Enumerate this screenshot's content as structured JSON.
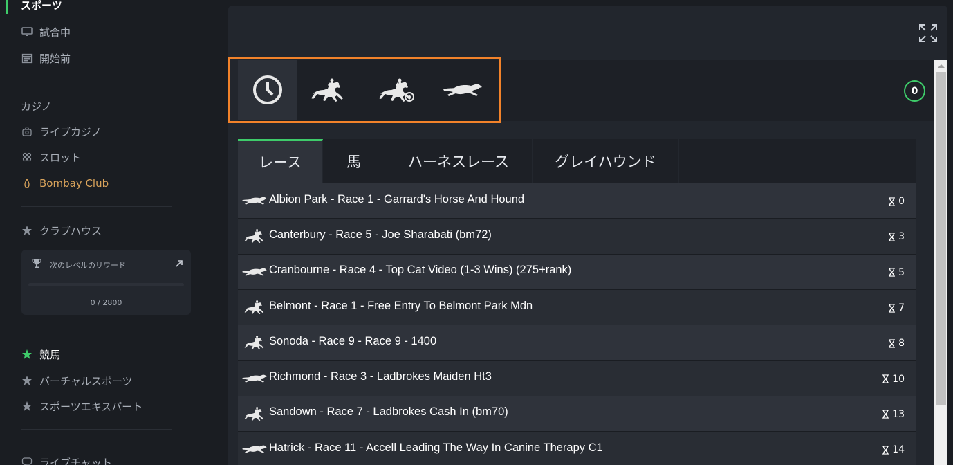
{
  "sidebar": {
    "sports_title": "スポーツ",
    "live": "試合中",
    "upcoming": "開始前",
    "casino_section": "カジノ",
    "live_casino": "ライブカジノ",
    "slots": "スロット",
    "bombay_club": "Bombay Club",
    "clubhouse": "クラブハウス",
    "reward": {
      "label": "次のレベルのリワード",
      "progress_text": "0 / 2800",
      "progress": 0
    },
    "racing": "競馬",
    "virtual_sports": "バーチャルスポーツ",
    "sports_expert": "スポーツエキスパート",
    "live_chat": "ライブチャット"
  },
  "filters": [
    "clock-icon",
    "horse-racing-icon",
    "harness-racing-icon",
    "greyhound-icon"
  ],
  "count_badge": "0",
  "tabs": [
    {
      "label": "レース"
    },
    {
      "label": "馬"
    },
    {
      "label": "ハーネスレース"
    },
    {
      "label": "グレイハウンド"
    }
  ],
  "races": [
    {
      "type": "greyhound",
      "name": "Albion Park - Race 1 - Garrard's Horse And Hound",
      "time": "0"
    },
    {
      "type": "horse",
      "name": "Canterbury - Race 5 - Joe Sharabati (bm72)",
      "time": "3"
    },
    {
      "type": "greyhound",
      "name": "Cranbourne - Race 4 - Top Cat Video (1-3 Wins) (275+rank)",
      "time": "5"
    },
    {
      "type": "horse",
      "name": "Belmont - Race 1 - Free Entry To Belmont Park Mdn",
      "time": "7"
    },
    {
      "type": "horse",
      "name": "Sonoda - Race 9 - Race 9 - 1400",
      "time": "8"
    },
    {
      "type": "greyhound",
      "name": "Richmond - Race 3 - Ladbrokes Maiden Ht3",
      "time": "10"
    },
    {
      "type": "horse",
      "name": "Sandown - Race 7 - Ladbrokes Cash In (bm70)",
      "time": "13"
    },
    {
      "type": "greyhound",
      "name": "Hatrick - Race 11 - Accell Leading The Way In Canine Therapy C1",
      "time": "14"
    }
  ],
  "colors": {
    "accent_green": "#3ecb6a",
    "highlight_orange": "#f2822a",
    "bombay_gold": "#d9a35b"
  }
}
